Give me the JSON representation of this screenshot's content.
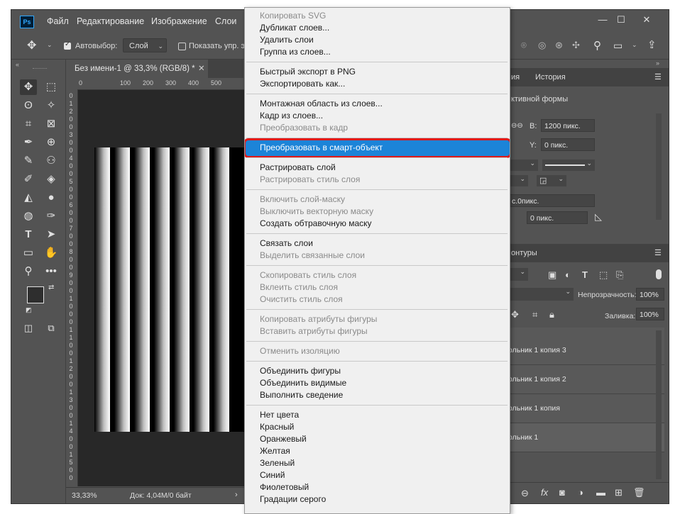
{
  "app": {
    "logo": "Ps",
    "menu": [
      "Файл",
      "Редактирование",
      "Изображение",
      "Слои"
    ],
    "window_controls": [
      "minimize",
      "maximize",
      "close"
    ]
  },
  "options_bar": {
    "auto_select_label": "Автовыбор:",
    "auto_select_checked": true,
    "auto_select_value": "Слой",
    "show_transform_label": "Показать упр. эл",
    "show_transform_checked": false
  },
  "document": {
    "tab_title": "Без имени-1 @ 33,3% (RGB/8) *",
    "ruler_top": [
      "0",
      "100",
      "200",
      "300",
      "400",
      "500"
    ],
    "ruler_left": [
      "0",
      "1",
      "2",
      "0",
      "0",
      "3",
      "0",
      "0",
      "4",
      "0",
      "0",
      "5",
      "0",
      "0",
      "6",
      "0",
      "0",
      "7",
      "0",
      "0",
      "8",
      "0",
      "0",
      "9",
      "0",
      "0",
      "1",
      "0",
      "0",
      "0",
      "1",
      "1",
      "0",
      "0",
      "1",
      "2",
      "0",
      "0",
      "1",
      "3",
      "0",
      "0",
      "1",
      "4",
      "0",
      "0",
      "1",
      "5",
      "0",
      "0"
    ],
    "stripe_count": 7,
    "zoom": "33,33%",
    "doc_info": "Док: 4,04M/0 байт"
  },
  "right_panel": {
    "tabs_top": [
      "ия",
      "История"
    ],
    "properties_title": "ктивной формы",
    "w_label": "В:",
    "w_value": "1200 пикс.",
    "y_label": "Y:",
    "y_value": "0 пикс.",
    "stroke_value": "с.0пикс.",
    "radius_value": "0 пикс.",
    "layers_tab": "онтуры",
    "opacity_label": "Непрозрачность:",
    "opacity_value": "100%",
    "fill_label": "Заливка:",
    "fill_value": "100%",
    "layers": [
      "ольник 1 копия 3",
      "ольник 1 копия 2",
      "ольник 1 копия",
      "ольник 1"
    ]
  },
  "context_menu": {
    "groups": [
      [
        {
          "label": "Копировать SVG",
          "enabled": false
        },
        {
          "label": "Дубликат слоев...",
          "enabled": true
        },
        {
          "label": "Удалить слои",
          "enabled": true
        },
        {
          "label": "Группа из слоев...",
          "enabled": true
        }
      ],
      [
        {
          "label": "Быстрый экспорт в PNG",
          "enabled": true
        },
        {
          "label": "Экспортировать как...",
          "enabled": true
        }
      ],
      [
        {
          "label": "Монтажная область из слоев...",
          "enabled": true
        },
        {
          "label": "Кадр из слоев...",
          "enabled": true
        },
        {
          "label": "Преобразовать в кадр",
          "enabled": false
        }
      ],
      [
        {
          "label": "Преобразовать в смарт-объект",
          "enabled": true,
          "selected": true
        }
      ],
      [
        {
          "label": "Растрировать слой",
          "enabled": true
        },
        {
          "label": "Растрировать стиль слоя",
          "enabled": false
        }
      ],
      [
        {
          "label": "Включить слой-маску",
          "enabled": false
        },
        {
          "label": "Выключить векторную маску",
          "enabled": false
        },
        {
          "label": "Создать обтравочную маску",
          "enabled": true
        }
      ],
      [
        {
          "label": "Связать слои",
          "enabled": true
        },
        {
          "label": "Выделить связанные слои",
          "enabled": false
        }
      ],
      [
        {
          "label": "Скопировать стиль слоя",
          "enabled": false
        },
        {
          "label": "Вклеить стиль слоя",
          "enabled": false
        },
        {
          "label": "Очистить стиль слоя",
          "enabled": false
        }
      ],
      [
        {
          "label": "Копировать атрибуты фигуры",
          "enabled": false
        },
        {
          "label": "Вставить атрибуты фигуры",
          "enabled": false
        }
      ],
      [
        {
          "label": "Отменить изоляцию",
          "enabled": false
        }
      ],
      [
        {
          "label": "Объединить фигуры",
          "enabled": true
        },
        {
          "label": "Объединить видимые",
          "enabled": true
        },
        {
          "label": "Выполнить сведение",
          "enabled": true
        }
      ],
      [
        {
          "label": "Нет цвета",
          "enabled": true
        },
        {
          "label": "Красный",
          "enabled": true
        },
        {
          "label": "Оранжевый",
          "enabled": true
        },
        {
          "label": "Желтая",
          "enabled": true
        },
        {
          "label": "Зеленый",
          "enabled": true
        },
        {
          "label": "Синий",
          "enabled": true
        },
        {
          "label": "Фиолетовый",
          "enabled": true
        },
        {
          "label": "Градации серого",
          "enabled": true
        }
      ]
    ]
  },
  "colors": {
    "ui_bg": "#535353",
    "canvas_bg": "#282828",
    "menu_bg": "#f0f0f0",
    "selection": "#1c84d8",
    "highlight_outline": "#e01a1a",
    "ps_blue": "#31a8ff"
  }
}
